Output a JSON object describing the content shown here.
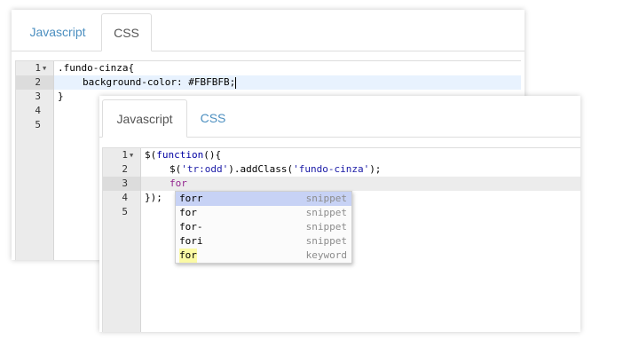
{
  "back_panel": {
    "tabs": [
      {
        "label": "Javascript"
      },
      {
        "label": "CSS"
      }
    ],
    "active_tab": "CSS",
    "line_numbers": [
      "1",
      "2",
      "3",
      "4",
      "5"
    ],
    "code": {
      "l1": ".fundo-cinza{",
      "l2_prop": "background-color: ",
      "l2_val": "#FBFBFB;",
      "l3": "}"
    }
  },
  "front_panel": {
    "tabs": [
      {
        "label": "Javascript"
      },
      {
        "label": "CSS"
      }
    ],
    "active_tab": "Javascript",
    "line_numbers": [
      "1",
      "2",
      "3",
      "4",
      "5"
    ],
    "code": {
      "l1_a": "$(",
      "l1_b": "function",
      "l1_c": "(){",
      "l2_a": "$(",
      "l2_b": "'tr:odd'",
      "l2_c": ").addClass(",
      "l2_d": "'fundo-cinza'",
      "l2_e": ");",
      "l3": "for",
      "l4": "});"
    },
    "autocomplete": {
      "items": [
        {
          "caption": "forr",
          "meta": "snippet"
        },
        {
          "caption": "for",
          "meta": "snippet"
        },
        {
          "caption": "for-",
          "meta": "snippet"
        },
        {
          "caption": "fori",
          "meta": "snippet"
        },
        {
          "caption": "for",
          "meta": "keyword"
        }
      ]
    }
  },
  "colors": {
    "tab_link": "#4c8fc0",
    "active_line": "#e8f2fe",
    "autocomplete_selected": "#c7d2f5"
  }
}
